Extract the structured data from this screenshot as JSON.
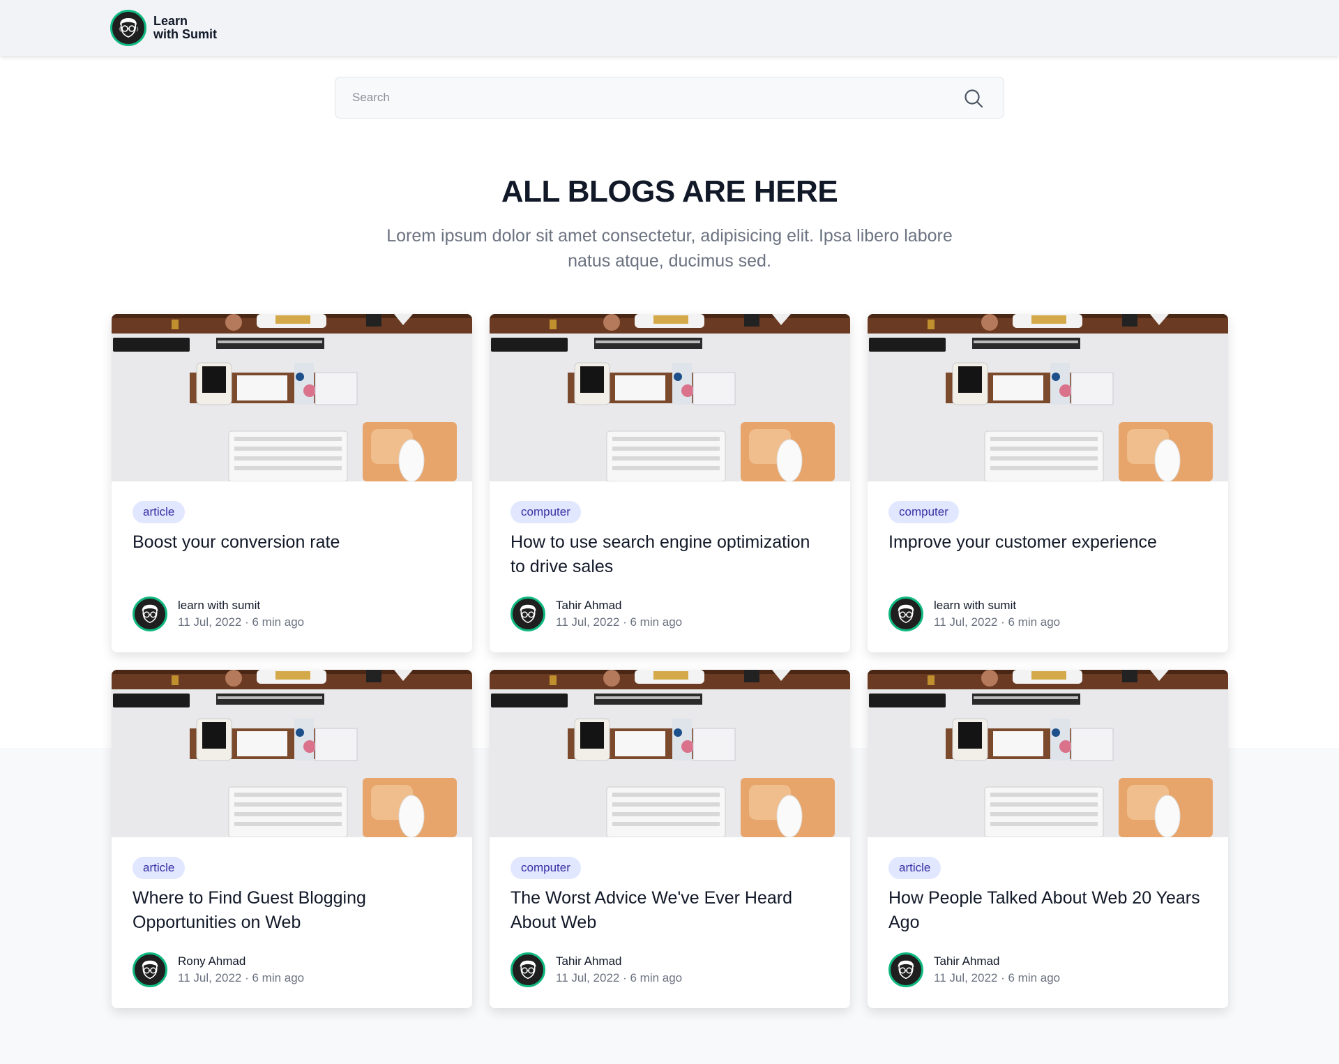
{
  "header": {
    "brand_line1": "Learn",
    "brand_line2": "with Sumit",
    "logo_icon": "coder-avatar-icon"
  },
  "search": {
    "placeholder": "Search",
    "value": "",
    "icon": "search-icon"
  },
  "hero": {
    "title": "ALL BLOGS ARE HERE",
    "subtitle": "Lorem ipsum dolor sit amet consectetur, adipisicing elit. Ipsa libero labore natus atque, ducimus sed."
  },
  "colors": {
    "accent_ring": "#10b981",
    "tag_bg": "#e0e7ff",
    "tag_text": "#3730a3"
  },
  "blogs": [
    {
      "tag": "article",
      "title": "Boost your conversion rate",
      "author": "learn with sumit",
      "date": "11 Jul, 2022",
      "read_time": "6 min ago"
    },
    {
      "tag": "computer",
      "title": "How to use search engine optimization to drive sales",
      "author": "Tahir Ahmad",
      "date": "11 Jul, 2022",
      "read_time": "6 min ago"
    },
    {
      "tag": "computer",
      "title": "Improve your customer experience",
      "author": "learn with sumit",
      "date": "11 Jul, 2022",
      "read_time": "6 min ago"
    },
    {
      "tag": "article",
      "title": "Where to Find Guest Blogging Opportunities on Web",
      "author": "Rony Ahmad",
      "date": "11 Jul, 2022",
      "read_time": "6 min ago"
    },
    {
      "tag": "computer",
      "title": "The Worst Advice We've Ever Heard About Web",
      "author": "Tahir Ahmad",
      "date": "11 Jul, 2022",
      "read_time": "6 min ago"
    },
    {
      "tag": "article",
      "title": "How People Talked About Web 20 Years Ago",
      "author": "Tahir Ahmad",
      "date": "11 Jul, 2022",
      "read_time": "6 min ago"
    }
  ]
}
